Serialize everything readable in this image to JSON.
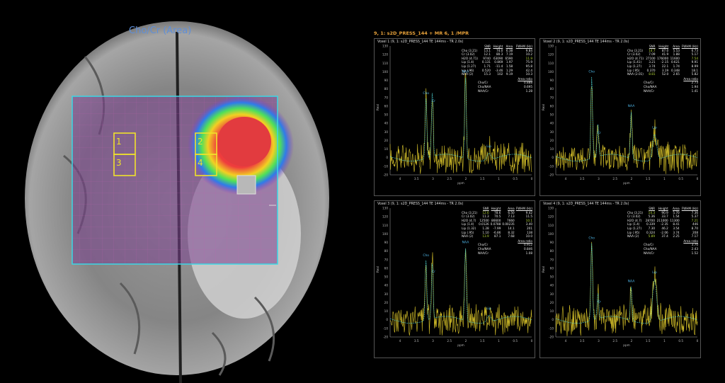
{
  "left_view": {
    "title": "Cho/Cr (Area)",
    "voxel_labels": [
      "1",
      "3",
      "2",
      "4"
    ]
  },
  "right_view": {
    "header": "9, 1: s2D_PRESS_144 + MR 6, 1 /MPR",
    "axis": {
      "x_label": "ppm",
      "y_label": "Real",
      "x_ticks": [
        "4",
        "3.5",
        "3",
        "2.5",
        "2",
        "1.5",
        "1",
        "0.5",
        "0"
      ],
      "y_ticks": [
        "130",
        "120",
        "110",
        "100",
        "90",
        "80",
        "70",
        "60",
        "50",
        "40",
        "30",
        "20",
        "10",
        "0",
        "-10",
        "-20"
      ]
    },
    "columns": [
      "SNR",
      "Height",
      "Area",
      "FWHM (Hz)"
    ],
    "ratio_header": "Area ratio",
    "panels": [
      {
        "title": "Voxel 1 (9, 1: s2D_PRESS_144 TE 144ms - TR 2.0s)",
        "rows": [
          [
            "Cho (3.21)",
            "13.1",
            "74.0",
            "6.38",
            "9.84"
          ],
          [
            "Cr (3.02)",
            "12.1",
            "80.3",
            "7.19",
            "10.2"
          ],
          [
            "H2O (4.71)",
            "9740",
            "63090",
            "6590",
            "11.9"
          ],
          [
            "Lip (1.4)",
            "0.131",
            "0.869",
            "1.97",
            "75.9"
          ],
          [
            "Lip (1.27)",
            "1.71",
            "-11.4",
            "1.58",
            "95.8"
          ],
          [
            "Lip (.96)",
            "0.520",
            "-3.46",
            "1.29",
            "42.4"
          ],
          [
            "NAA (2)",
            "15.3",
            "102",
            "9.19",
            "10.3"
          ]
        ],
        "ratios": [
          [
            "Cho/Cr",
            "0.888"
          ],
          [
            "Cho/NAA",
            "0.695"
          ],
          [
            "NAA/Cr",
            "1.28"
          ]
        ],
        "peaks": [
          "Cho",
          "Cr",
          "NAA",
          "Lip"
        ]
      },
      {
        "title": "Voxel 2 (9, 1: s2D_PRESS_144 TE 144ms - TR 2.0s)",
        "rows": [
          [
            "Cho (3.21)",
            "14.7",
            "87.0",
            "5.53",
            "6.73"
          ],
          [
            "Cr (3.02)",
            "7.09",
            "41.9",
            "1.88",
            "5.17"
          ],
          [
            "H2O (4.71)",
            "27100",
            "176000",
            "11600",
            "7.54"
          ],
          [
            "Lip (1.41)",
            "3.21",
            "-2.15",
            "0.621",
            "9.91"
          ],
          [
            "Lip (1.27)",
            "3.74",
            "22.1",
            "1.74",
            "8.99"
          ],
          [
            "Lip (.95)",
            "0.370",
            "3.19",
            "0.348",
            "18.1"
          ],
          [
            "NAA (2.01)",
            "8.81",
            "52.0",
            "2.65",
            "5.82"
          ]
        ],
        "ratios": [
          [
            "Cho/Cr",
            "2.73"
          ],
          [
            "Cho/NAA",
            "1.94"
          ],
          [
            "NAA/Cr",
            "1.41"
          ]
        ],
        "peaks": [
          "Cho",
          "Cr",
          "NAA",
          "Lip"
        ]
      },
      {
        "title": "Voxel 3 (9, 1: s2D_PRESS_144 TE 144ms - TR 2.0s)",
        "rows": [
          [
            "Cho (3.21)",
            "12.6",
            "78.6",
            "6.50",
            "9.42"
          ],
          [
            "Cr (3.02)",
            "11.3",
            "70.5",
            "7.13",
            "11.5"
          ],
          [
            "H2O (4.7)",
            "12500",
            "86600",
            "7660",
            "10.1"
          ],
          [
            "Lip (1.4)",
            "0.0126",
            "0.0788",
            "0.00235",
            "3.40"
          ],
          [
            "Lip (1.32)",
            "1.28",
            "-7.99",
            "14.1",
            "201"
          ],
          [
            "Lip (.95)",
            "1.10",
            "-6.86",
            "8.32",
            "138"
          ],
          [
            "NAA (2)",
            "13.9",
            "87.1",
            "7.68",
            "10.0"
          ]
        ],
        "ratios": [
          [
            "Cho/Cr",
            "0.912"
          ],
          [
            "Cho/NAA",
            "0.846"
          ],
          [
            "NAA/Cr",
            "1.08"
          ]
        ],
        "peaks": [
          "Cho",
          "Cr",
          "NAA",
          "Lip"
        ]
      },
      {
        "title": "Voxel 4 (9, 1: s2D_PRESS_144 TE 144ms - TR 2.0s)",
        "rows": [
          [
            "Cho (3.21)",
            "14.3",
            "90.9",
            "5.70",
            "7.36"
          ],
          [
            "Cr (3.02)",
            "5.36",
            "33.7",
            "1.54",
            "5.37"
          ],
          [
            "H2O (4.7)",
            "28700",
            "211000",
            "11300",
            "7.21"
          ],
          [
            "Lip (1.4)",
            "0.339",
            "-2.35",
            "8.41",
            "446"
          ],
          [
            "Lip (1.27)",
            "7.30",
            "46.2",
            "3.54",
            "8.70"
          ],
          [
            "Lip (.95)",
            "0.324",
            "-2.06",
            "3.74",
            "208"
          ],
          [
            "NAA (2)",
            "5.89",
            "37.4",
            "2.25",
            "7.17"
          ]
        ],
        "ratios": [
          [
            "Cho/Cr",
            "3.70"
          ],
          [
            "Cho/NAA",
            "2.43"
          ],
          [
            "NAA/Cr",
            "1.52"
          ]
        ],
        "peaks": [
          "Cho",
          "Cr",
          "NAA",
          "Lip"
        ]
      }
    ]
  },
  "colors": {
    "spectrum": "#d8c32a",
    "fit": "#4fd8d8",
    "grid_box": "#3ad7e6",
    "voxel_box": "#f0e12a",
    "label": "#4fb6e8",
    "header": "#e8a23a"
  }
}
